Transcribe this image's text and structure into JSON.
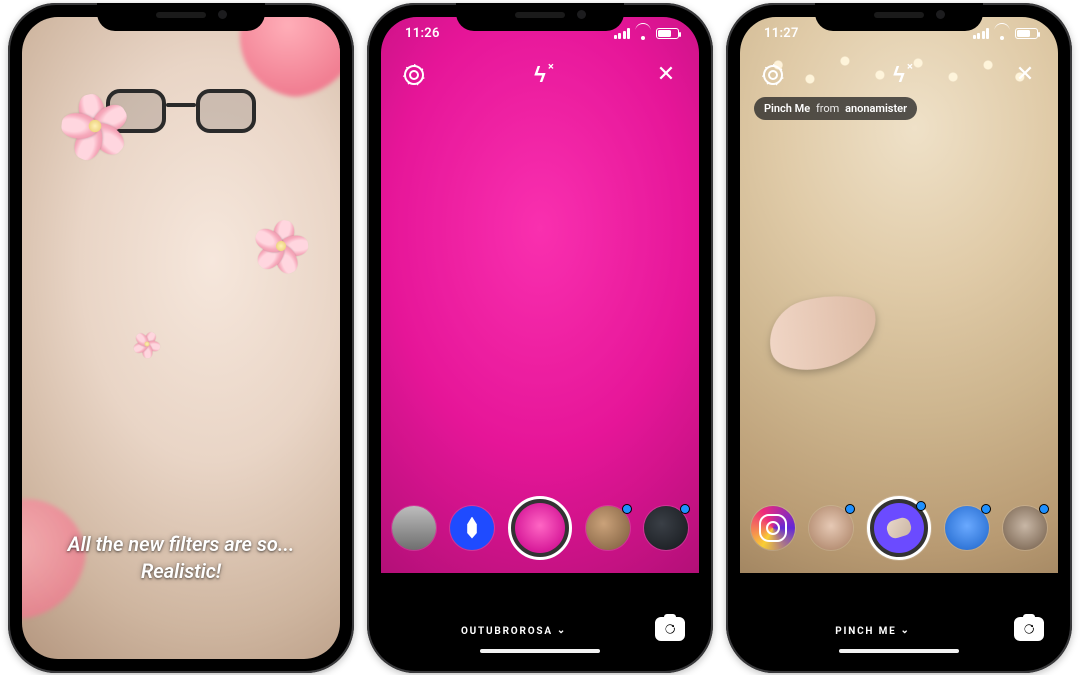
{
  "phone1": {
    "caption_line1": "All the new filters are so...",
    "caption_line2": "Realistic!"
  },
  "phone2": {
    "status_time": "11:26",
    "filter_name": "OUTUBROROSA",
    "icons": {
      "settings": "settings-icon",
      "flash": "flash-off-icon",
      "close": "close-icon",
      "switch_camera": "switch-camera-icon"
    },
    "effects": [
      {
        "id": "gray",
        "has_new": false
      },
      {
        "id": "water-blue",
        "has_new": false
      },
      {
        "id": "outubrorosa",
        "center": true,
        "has_new": false
      },
      {
        "id": "brown",
        "has_new": true
      },
      {
        "id": "dark",
        "has_new": true
      }
    ]
  },
  "phone3": {
    "status_time": "11:27",
    "filter_name": "PINCH ME",
    "filter_pill_name": "Pinch Me",
    "filter_pill_from": "from",
    "filter_pill_author": "anonamister",
    "icons": {
      "settings": "settings-icon",
      "flash": "flash-off-icon",
      "close": "close-icon",
      "switch_camera": "switch-camera-icon"
    },
    "effects": [
      {
        "id": "instagram",
        "has_new": false
      },
      {
        "id": "face",
        "has_new": true
      },
      {
        "id": "pinch-me",
        "center": true,
        "has_new": true
      },
      {
        "id": "photo",
        "has_new": true
      },
      {
        "id": "man",
        "has_new": true
      }
    ]
  }
}
